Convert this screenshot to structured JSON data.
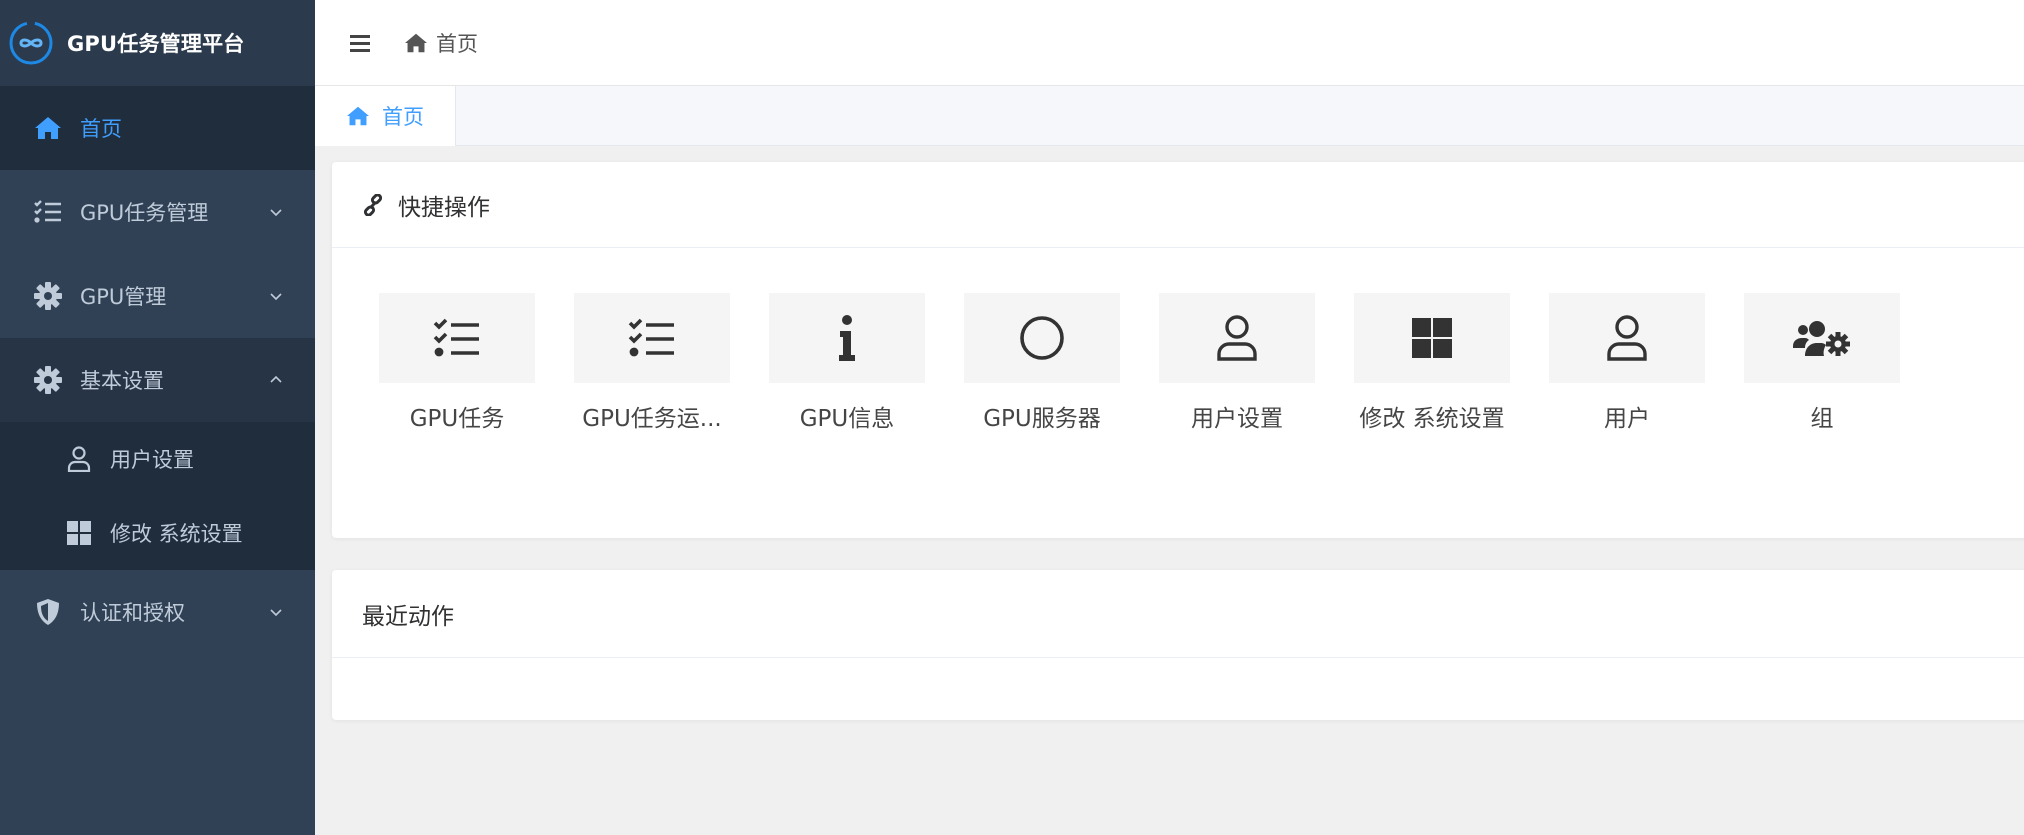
{
  "brand": {
    "title": "GPU任务管理平台",
    "logo_icon": "infinity-icon",
    "accent": "#409eff"
  },
  "sidebar": {
    "items": [
      {
        "label": "首页",
        "icon": "home-icon"
      },
      {
        "label": "GPU任务管理",
        "icon": "task-list-icon"
      },
      {
        "label": "GPU管理",
        "icon": "gear-icon"
      },
      {
        "label": "基本设置",
        "icon": "gear-icon"
      },
      {
        "label": "认证和授权",
        "icon": "shield-icon"
      }
    ],
    "subitems": [
      {
        "label": "用户设置",
        "icon": "user-icon"
      },
      {
        "label": "修改 系统设置",
        "icon": "windows-icon"
      }
    ]
  },
  "header": {
    "breadcrumb": "首页"
  },
  "tabs": [
    {
      "label": "首页"
    }
  ],
  "quick": {
    "title": "快捷操作",
    "actions": [
      {
        "label": "GPU任务",
        "icon": "task-list-icon"
      },
      {
        "label": "GPU任务运...",
        "icon": "task-list-icon"
      },
      {
        "label": "GPU信息",
        "icon": "info-icon"
      },
      {
        "label": "GPU服务器",
        "icon": "circle-icon"
      },
      {
        "label": "用户设置",
        "icon": "user-icon"
      },
      {
        "label": "修改 系统设置",
        "icon": "windows-icon"
      },
      {
        "label": "用户",
        "icon": "user-icon"
      },
      {
        "label": "组",
        "icon": "users-gear-icon"
      }
    ]
  },
  "recent": {
    "title": "最近动作"
  }
}
